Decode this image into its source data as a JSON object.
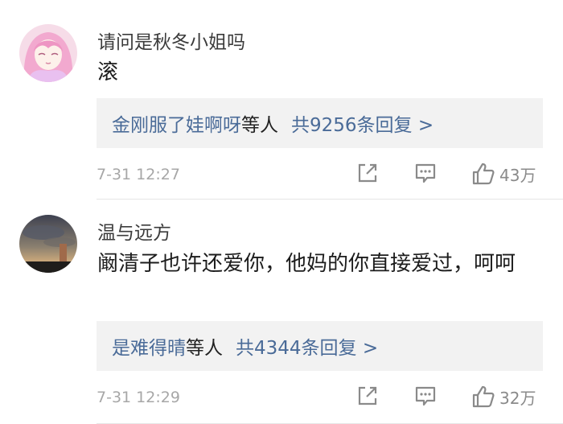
{
  "comments": [
    {
      "username": "请问是秋冬小姐吗",
      "content": "滚",
      "reply_users": "金刚服了娃啊呀",
      "reply_tail": "等人",
      "reply_count": "共9256条回复 >",
      "time": "7-31 12:27",
      "likes": "43万",
      "avatar": "anime-girl-avatar"
    },
    {
      "username": "温与远方",
      "content": "阚清子也许还爱你，他妈的你直接爱过，呵呵",
      "reply_users": "是难得晴",
      "reply_tail": "等人",
      "reply_count": "共4344条回复 >",
      "time": "7-31 12:29",
      "likes": "32万",
      "avatar": "sunset-sky-avatar"
    }
  ],
  "icons": {
    "share": "share-icon",
    "comment": "comment-icon",
    "like": "thumbs-up-icon"
  },
  "colors": {
    "link": "#4a6b98",
    "meta": "#a7a7a7",
    "reply_bg": "#f2f2f2"
  }
}
